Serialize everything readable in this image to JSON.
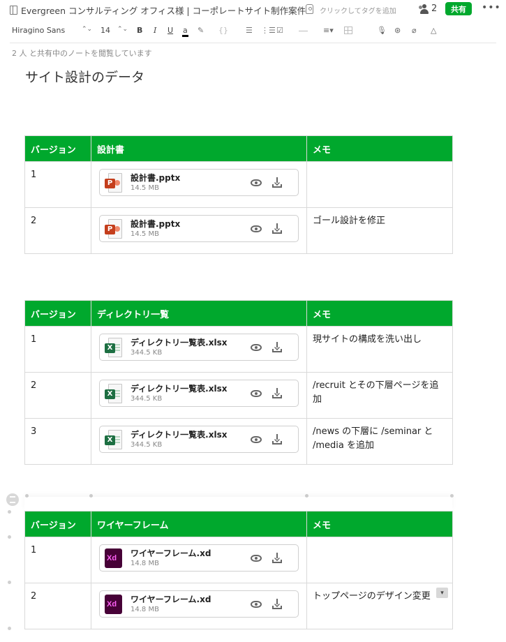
{
  "header": {
    "note_title": "Evergreen コンサルティング オフィス様 | コーポレートサイト制作案件",
    "tag_placeholder": "クリックしてタグを追加",
    "shared_user_count": "2",
    "share_button": "共有",
    "more_menu": "•••"
  },
  "toolbar": {
    "font_family": "Hiragino Sans",
    "font_size": "14",
    "bold": "B",
    "italic": "I",
    "underline": "U",
    "text_color": "a",
    "highlight": "✎",
    "code": "{}",
    "bullet_list": "☰",
    "numbered_list": "⋮☰",
    "checklist": "☑",
    "align": "≡▾",
    "mic": "🎙",
    "dribbble": "⊛",
    "attachment": "⌀",
    "drive": "△"
  },
  "shared_notice": "2 人 と共有中のノートを閲覧しています",
  "page_title": "サイト設計のデータ",
  "tables": [
    {
      "headers": [
        "バージョン",
        "設計書",
        "メモ"
      ],
      "rows": [
        {
          "version": "1",
          "file": {
            "name": "設計書.pptx",
            "size": "14.5 MB",
            "type": "pptx",
            "badge": "P"
          },
          "memo": ""
        },
        {
          "version": "2",
          "file": {
            "name": "設計書.pptx",
            "size": "14.5 MB",
            "type": "pptx",
            "badge": "P"
          },
          "memo": "ゴール設計を修正"
        }
      ]
    },
    {
      "headers": [
        "バージョン",
        "ディレクトリ一覧",
        "メモ"
      ],
      "rows": [
        {
          "version": "1",
          "file": {
            "name": "ディレクトリ一覧表.xlsx",
            "size": "344.5 KB",
            "type": "xlsx",
            "badge": "X"
          },
          "memo": "現サイトの構成を洗い出し"
        },
        {
          "version": "2",
          "file": {
            "name": "ディレクトリ一覧表.xlsx",
            "size": "344.5 KB",
            "type": "xlsx",
            "badge": "X"
          },
          "memo": "/recruit とその下層ページを追加"
        },
        {
          "version": "3",
          "file": {
            "name": "ディレクトリ一覧表.xlsx",
            "size": "344.5 KB",
            "type": "xlsx",
            "badge": "X"
          },
          "memo": "/news の下層に /seminar と /media を追加"
        }
      ]
    },
    {
      "headers": [
        "バージョン",
        "ワイヤーフレーム",
        "メモ"
      ],
      "rows": [
        {
          "version": "1",
          "file": {
            "name": "ワイヤーフレーム.xd",
            "size": "14.8 MB",
            "type": "xd",
            "badge": "Xd"
          },
          "memo": ""
        },
        {
          "version": "2",
          "file": {
            "name": "ワイヤーフレーム.xd",
            "size": "14.8 MB",
            "type": "xd",
            "badge": "Xd"
          },
          "memo": "トップページのデザイン変更"
        }
      ]
    }
  ],
  "colors": {
    "accent": "#00a82d",
    "table_border": "#d9d9d9"
  },
  "icons": {
    "note": "note-icon",
    "tag": "tag-icon",
    "people": "people-icon",
    "preview": "eye-icon",
    "download": "download-icon"
  }
}
